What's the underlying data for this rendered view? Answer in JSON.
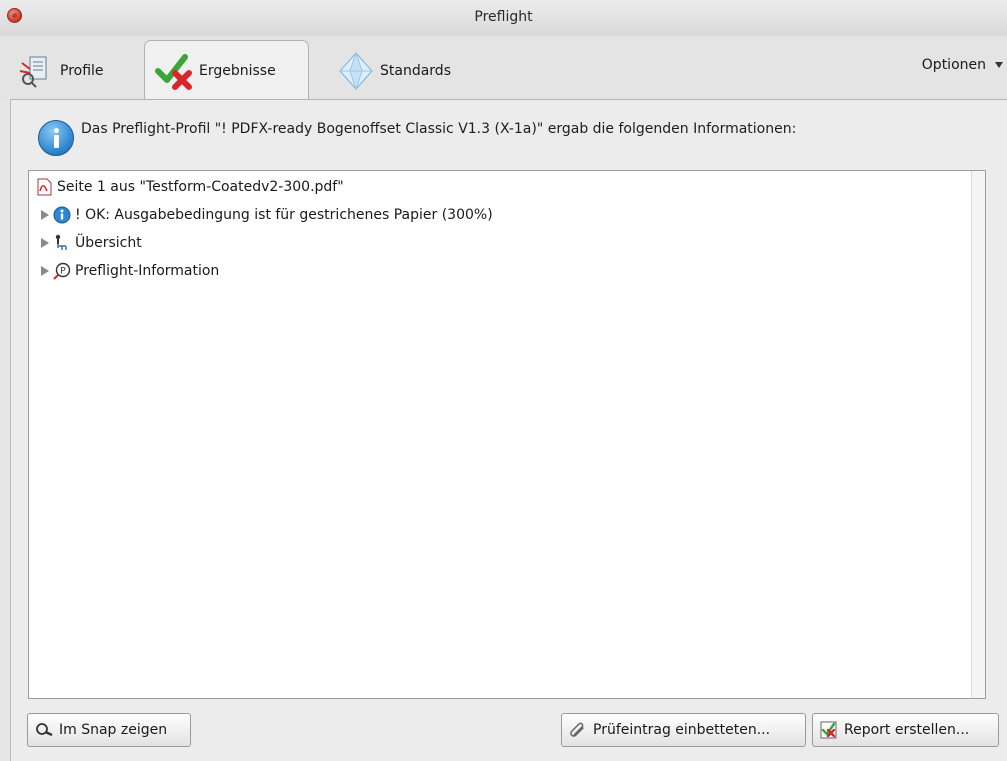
{
  "window": {
    "title": "Preflight"
  },
  "tabs": [
    {
      "label": "Profile",
      "icon": "profile-icon"
    },
    {
      "label": "Ergebnisse",
      "icon": "results-check-icon",
      "selected": true
    },
    {
      "label": "Standards",
      "icon": "standards-diamond-icon"
    }
  ],
  "options_menu": {
    "label": "Optionen"
  },
  "info_message": "Das Preflight-Profil \"! PDFX-ready Bogenoffset Classic V1.3 (X-1a)\" ergab die folgenden Informationen:",
  "tree": {
    "root": {
      "label": "Seite 1 aus \"Testform-Coatedv2-300.pdf\"",
      "icon": "pdf-file-icon"
    },
    "items": [
      {
        "label": "! OK: Ausgabebedingung ist für gestrichenes Papier (300%)",
        "icon": "info-globe-icon"
      },
      {
        "label": "Übersicht",
        "icon": "overview-hierarchy-icon"
      },
      {
        "label": "Preflight-Information",
        "icon": "preflight-info-icon"
      }
    ]
  },
  "buttons": {
    "snap": "Im Snap zeigen",
    "embed": "Prüfeintrag einbetteten...",
    "report": "Report erstellen..."
  },
  "colors": {
    "accent_blue": "#2f87d1",
    "close_red": "#d0402f",
    "check_green": "#3aa63a",
    "x_red": "#d8262a"
  }
}
